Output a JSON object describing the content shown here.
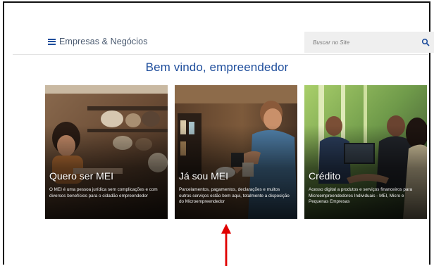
{
  "header": {
    "brand": "Empresas & Negócios",
    "search_placeholder": "Buscar no Site"
  },
  "welcome_title": "Bem vindo, empreendedor",
  "cards": [
    {
      "title": "Quero ser MEI",
      "description": "O MEI é uma pessoa jurídica sem complicações e com diversos benefícios para o cidadão empreendedor"
    },
    {
      "title": "Já sou MEI",
      "description": "Parcelamentos, pagamentos, declarações e muitos outros serviços estão bem aqui, totalmente a disposição do Microempreendedor"
    },
    {
      "title": "Crédito",
      "description": "Acesso digital a produtos e serviços financeiros para Microempreendedores Individuais - MEI, Micro e Pequenas Empresas"
    }
  ],
  "colors": {
    "brand_blue": "#1f4e9c",
    "arrow_red": "#e00000"
  },
  "icons": {
    "menu": "menu-icon",
    "search": "search-icon",
    "annotation": "red-arrow-icon"
  }
}
